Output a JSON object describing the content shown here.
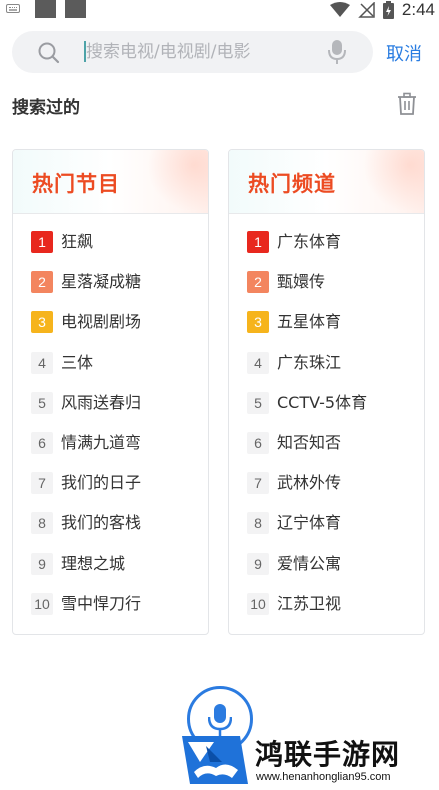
{
  "status_bar": {
    "time": "2:44"
  },
  "search": {
    "placeholder": "搜索电视/电视剧/电影",
    "value": ""
  },
  "cancel_label": "取消",
  "history": {
    "title": "搜索过的"
  },
  "hot_programs": {
    "title": "热门节目",
    "items": [
      {
        "rank": "1",
        "name": "狂飙"
      },
      {
        "rank": "2",
        "name": "星落凝成糖"
      },
      {
        "rank": "3",
        "name": "电视剧剧场"
      },
      {
        "rank": "4",
        "name": "三体"
      },
      {
        "rank": "5",
        "name": "风雨送春归"
      },
      {
        "rank": "6",
        "name": "情满九道弯"
      },
      {
        "rank": "7",
        "name": "我们的日子"
      },
      {
        "rank": "8",
        "name": "我们的客栈"
      },
      {
        "rank": "9",
        "name": "理想之城"
      },
      {
        "rank": "10",
        "name": "雪中悍刀行"
      }
    ]
  },
  "hot_channels": {
    "title": "热门频道",
    "items": [
      {
        "rank": "1",
        "name": "广东体育"
      },
      {
        "rank": "2",
        "name": "甄嬛传"
      },
      {
        "rank": "3",
        "name": "五星体育"
      },
      {
        "rank": "4",
        "name": "广东珠江"
      },
      {
        "rank": "5",
        "name": "CCTV-5体育"
      },
      {
        "rank": "6",
        "name": "知否知否"
      },
      {
        "rank": "7",
        "name": "武林外传"
      },
      {
        "rank": "8",
        "name": "辽宁体育"
      },
      {
        "rank": "9",
        "name": "爱情公寓"
      },
      {
        "rank": "10",
        "name": "江苏卫视"
      }
    ]
  },
  "colors": {
    "accent_blue": "#2a7de1",
    "title_orange": "#ec4b22",
    "rank1": "#e8281e",
    "rank2": "#f3855f",
    "rank3": "#f6b41c"
  },
  "icons": [
    "keyboard-icon",
    "wifi-icon",
    "no-signal-icon",
    "battery-icon",
    "search-icon",
    "microphone-icon",
    "trash-icon"
  ],
  "watermark": {
    "text": "鸿联手游网",
    "url": "www.henanhonglian95.com"
  }
}
